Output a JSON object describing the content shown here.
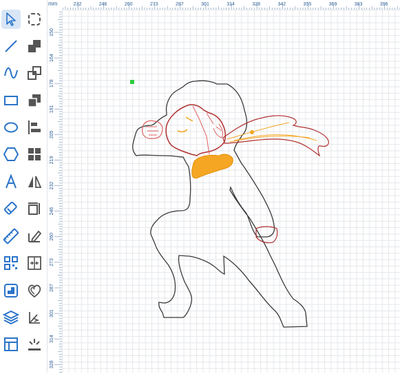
{
  "ruler": {
    "unit": "mm",
    "top_labels": [
      "232",
      "246",
      "260",
      "273",
      "287",
      "301",
      "314",
      "328",
      "342",
      "355",
      "369",
      "383",
      "396"
    ],
    "left_labels": [
      "150",
      "164",
      "178",
      "191",
      "205",
      "219",
      "232",
      "246",
      "260",
      "273",
      "287",
      "301",
      "314",
      "328"
    ]
  },
  "toolbar": {
    "tools": [
      {
        "name": "select-tool",
        "icon": "cursor-arrow-icon",
        "active": true
      },
      {
        "name": "crop-tool",
        "icon": "dashed-rounded-square-icon"
      },
      {
        "name": "line-tool",
        "icon": "line-icon"
      },
      {
        "name": "arrange-back-tool",
        "icon": "stack-back-icon"
      },
      {
        "name": "curve-tool",
        "icon": "curve-icon"
      },
      {
        "name": "arrange-front-tool",
        "icon": "stack-front-icon"
      },
      {
        "name": "rectangle-tool",
        "icon": "rectangle-icon"
      },
      {
        "name": "group-tool",
        "icon": "layers-square-icon"
      },
      {
        "name": "ellipse-tool",
        "icon": "ellipse-icon"
      },
      {
        "name": "align-tool",
        "icon": "align-left-icon"
      },
      {
        "name": "polygon-tool",
        "icon": "hexagon-icon"
      },
      {
        "name": "grid-tool",
        "icon": "grid-icon"
      },
      {
        "name": "text-tool",
        "icon": "letter-a-icon"
      },
      {
        "name": "flip-tool",
        "icon": "mirror-triangle-icon"
      },
      {
        "name": "eraser-tool",
        "icon": "eraser-icon"
      },
      {
        "name": "resize-tool",
        "icon": "resize-frame-icon"
      },
      {
        "name": "ruler-tool",
        "icon": "ruler-icon"
      },
      {
        "name": "edit-path-tool",
        "icon": "pencil-path-icon"
      },
      {
        "name": "qr-code-tool",
        "icon": "qr-code-icon"
      },
      {
        "name": "distribute-tool",
        "icon": "distribute-icon"
      },
      {
        "name": "image-tool",
        "icon": "image-frame-icon"
      },
      {
        "name": "offset-tool",
        "icon": "offset-heart-icon"
      },
      {
        "name": "layers-tool",
        "icon": "layers-icon"
      },
      {
        "name": "weld-tool",
        "icon": "weld-icon"
      },
      {
        "name": "template-tool",
        "icon": "template-icon"
      },
      {
        "name": "burst-tool",
        "icon": "sparkle-burst-icon"
      }
    ]
  },
  "colors": {
    "accent": "#2a74c9",
    "outline": "#3a3a3a",
    "red_outline": "#e06060",
    "orange_fill": "#f5a623",
    "handle_green": "#2ecc40"
  }
}
